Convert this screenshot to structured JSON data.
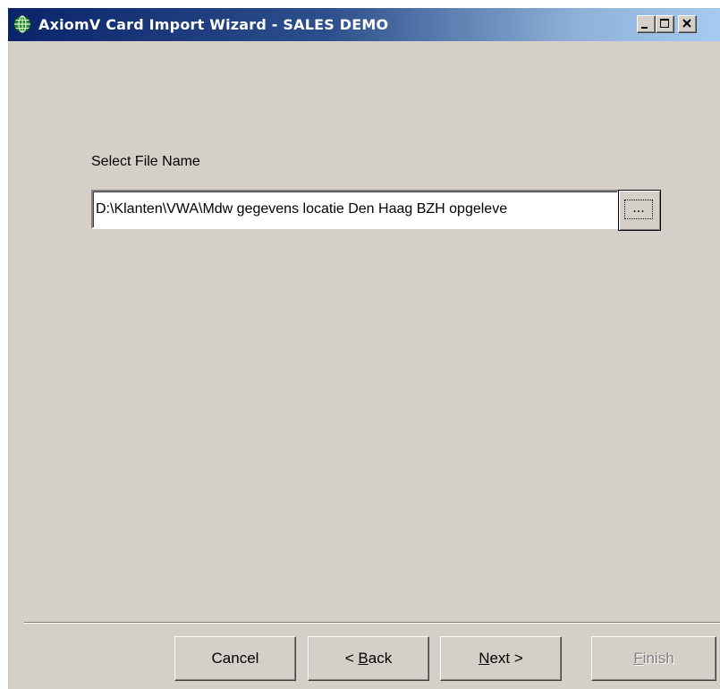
{
  "window": {
    "title": "AxiomV  Card Import Wizard - SALES DEMO",
    "controls": [
      "minimize",
      "maximize",
      "close"
    ]
  },
  "form": {
    "file_label": "Select File Name",
    "file_path": "D:\\Klanten\\VWA\\Mdw gegevens locatie Den Haag BZH opgeleve",
    "browse_label": "..."
  },
  "buttons": {
    "cancel": "Cancel",
    "back_prefix": "< ",
    "back_mnemonic": "B",
    "back_rest": "ack",
    "next_mnemonic": "N",
    "next_rest": "ext >",
    "finish_mnemonic": "F",
    "finish_rest": "inish",
    "finish_enabled": false
  },
  "colors": {
    "titlebar_start": "#0a246a",
    "titlebar_end": "#a6caf0",
    "face": "#d4d0c8"
  }
}
